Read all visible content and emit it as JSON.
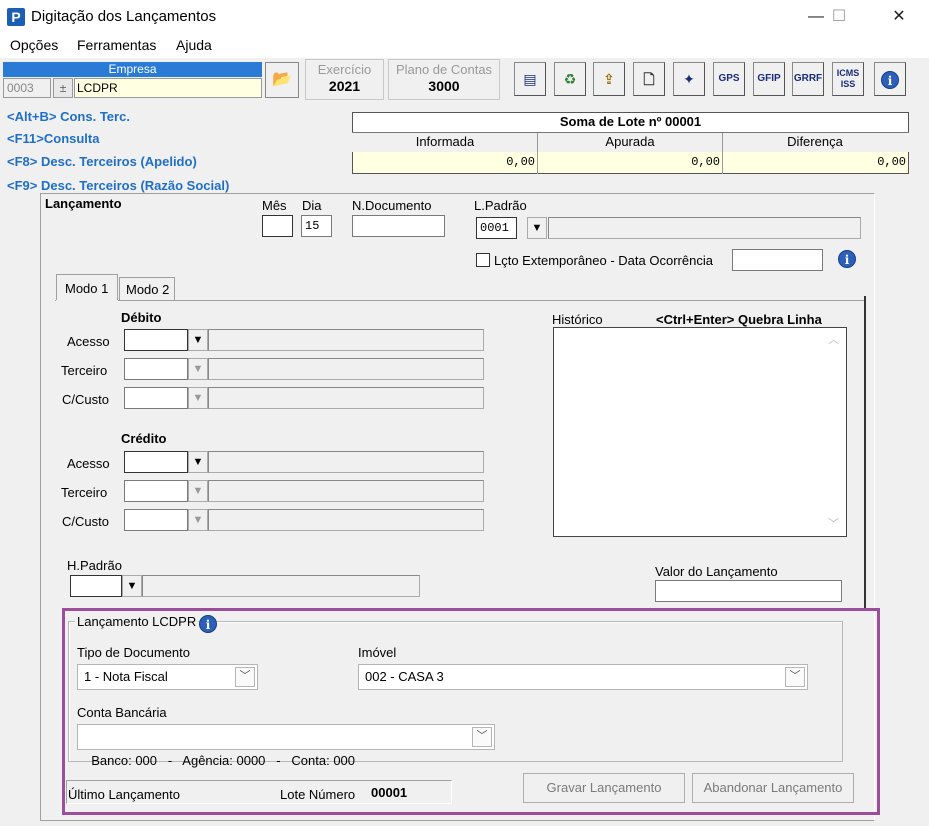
{
  "window": {
    "title": "Digitação dos Lançamentos",
    "app_icon_letter": "P",
    "min_glyph": "—",
    "max_glyph": "☐",
    "close_glyph": "✕"
  },
  "menu": [
    "Opções",
    "Ferramentas",
    "Ajuda"
  ],
  "empresa": {
    "label": "Empresa",
    "code": "0003",
    "name": "LCDPR",
    "spinner_glyph": "±"
  },
  "exercicio": {
    "label": "Exercício",
    "value": "2021"
  },
  "plano": {
    "label": "Plano de Contas",
    "value": "3000"
  },
  "toolbar": {
    "open_glyph": "📂",
    "icons": [
      {
        "name": "report-icon",
        "glyph": "▤"
      },
      {
        "name": "recycle-icon",
        "glyph": "♻"
      },
      {
        "name": "export-icon",
        "glyph": "⇪"
      },
      {
        "name": "new-page-icon",
        "glyph": "🗋"
      },
      {
        "name": "gear-icon",
        "glyph": "✦"
      }
    ],
    "text_buttons": [
      "GPS",
      "GFIP",
      "GRRF",
      "ICMS ISS"
    ],
    "info_glyph": "i"
  },
  "shortcuts": [
    "<Alt+B> Cons. Terc.",
    "<F11>Consulta",
    "<F8> Desc. Terceiros (Apelido)",
    "<F9> Desc. Terceiros (Razão Social)"
  ],
  "soma": {
    "title": "Soma de Lote nº 00001",
    "headers": [
      "Informada",
      "Apurada",
      "Diferença"
    ],
    "values": [
      "0,00",
      "0,00",
      "0,00"
    ]
  },
  "lancamento": {
    "section_label": "Lançamento",
    "mes_label": "Mês",
    "mes_value": "",
    "dia_label": "Dia",
    "dia_value": "15",
    "ndoc_label": "N.Documento",
    "ndoc_value": "",
    "lpadrao_label": "L.Padrão",
    "lpadrao_value": "0001",
    "extemporaneo_label": "Lçto Extemporâneo - Data Ocorrência",
    "data_ocorrencia": ""
  },
  "tabs": [
    {
      "label": "Modo 1",
      "active": true
    },
    {
      "label": "Modo 2",
      "active": false
    }
  ],
  "debito": {
    "title": "Débito",
    "fields": [
      "Acesso",
      "Terceiro",
      "C/Custo"
    ]
  },
  "credito": {
    "title": "Crédito",
    "fields": [
      "Acesso",
      "Terceiro",
      "C/Custo"
    ]
  },
  "historico": {
    "label": "Histórico",
    "hint": "<Ctrl+Enter> Quebra Linha",
    "value": ""
  },
  "hpadrao": {
    "label": "H.Padrão",
    "value": ""
  },
  "valor": {
    "label": "Valor do Lançamento",
    "value": ""
  },
  "lcdpr": {
    "group_label": "Lançamento LCDPR",
    "tipo_label": "Tipo de Documento",
    "tipo_value": "1 - Nota Fiscal",
    "imovel_label": "Imóvel",
    "imovel_value": "002 - CASA 3",
    "conta_label": "Conta Bancária",
    "conta_value": "Banco: 000   -   Agência: 0000   -   Conta: 000"
  },
  "footer": {
    "ultimo_label": "Último Lançamento",
    "lote_label": "Lote Número",
    "lote_value": "00001",
    "gravar_label": "Gravar Lançamento",
    "abandonar_label": "Abandonar Lançamento"
  },
  "colors": {
    "highlight_border": "#9b4f9b",
    "empresa_header": "#2a7bd6",
    "shortcut_text": "#1f6fc8",
    "readonly_yellow": "#ffffe1"
  }
}
